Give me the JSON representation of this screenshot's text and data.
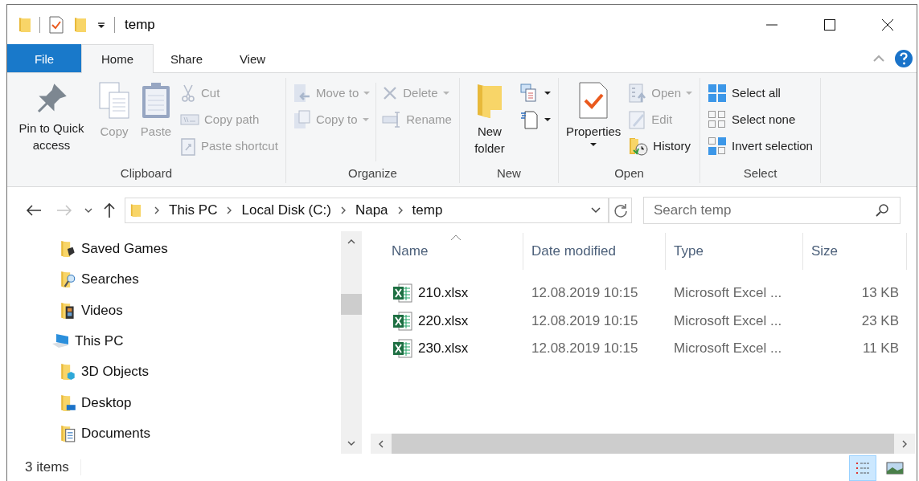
{
  "window": {
    "title": "temp"
  },
  "ribbon_tabs": [
    {
      "label": "File",
      "kind": "file",
      "selected": false
    },
    {
      "label": "Home",
      "kind": "tab",
      "selected": true
    },
    {
      "label": "Share",
      "kind": "tab",
      "selected": false
    },
    {
      "label": "View",
      "kind": "tab",
      "selected": false
    }
  ],
  "ribbon": {
    "groups": [
      {
        "label": "Clipboard",
        "columns": [
          [
            {
              "kind": "large",
              "label": "Pin to Quick access",
              "disabled": false,
              "dropdown": false
            }
          ],
          [
            {
              "kind": "large",
              "label": "Copy",
              "disabled": true,
              "dropdown": false
            }
          ],
          [
            {
              "kind": "large",
              "label": "Paste",
              "disabled": true,
              "dropdown": false
            }
          ],
          [
            {
              "kind": "small",
              "label": "Cut",
              "disabled": true,
              "dropdown": false
            },
            {
              "kind": "small",
              "label": "Copy path",
              "disabled": true,
              "dropdown": false
            },
            {
              "kind": "small",
              "label": "Paste shortcut",
              "disabled": true,
              "dropdown": false
            }
          ]
        ]
      },
      {
        "label": "Organize",
        "columns": [
          [
            {
              "kind": "small",
              "label": "Move to",
              "disabled": true,
              "dropdown": true
            },
            {
              "kind": "small",
              "label": "Copy to",
              "disabled": true,
              "dropdown": true
            }
          ],
          [
            {
              "kind": "small",
              "label": "Delete",
              "disabled": true,
              "dropdown": true
            },
            {
              "kind": "small",
              "label": "Rename",
              "disabled": true,
              "dropdown": false
            }
          ]
        ]
      },
      {
        "label": "New",
        "columns": [
          [
            {
              "kind": "large",
              "label": "New folder",
              "disabled": false,
              "dropdown": false
            }
          ],
          [
            {
              "kind": "icon",
              "disabled": false,
              "dropdown": true
            },
            {
              "kind": "icon",
              "disabled": false,
              "dropdown": true
            }
          ]
        ]
      },
      {
        "label": "Open",
        "columns": [
          [
            {
              "kind": "large",
              "label": "Properties",
              "disabled": false,
              "dropdown": true
            }
          ],
          [
            {
              "kind": "small",
              "label": "Open",
              "disabled": true,
              "dropdown": true
            },
            {
              "kind": "small",
              "label": "Edit",
              "disabled": true,
              "dropdown": false
            },
            {
              "kind": "small",
              "label": "History",
              "disabled": false,
              "dropdown": false
            }
          ]
        ]
      },
      {
        "label": "Select",
        "columns": [
          [
            {
              "kind": "small",
              "label": "Select all",
              "disabled": false,
              "dropdown": false
            },
            {
              "kind": "small",
              "label": "Select none",
              "disabled": false,
              "dropdown": false
            },
            {
              "kind": "small",
              "label": "Invert selection",
              "disabled": false,
              "dropdown": false
            }
          ]
        ]
      }
    ]
  },
  "navigation": {
    "forward_disabled": true
  },
  "breadcrumb": [
    "This PC",
    "Local Disk (C:)",
    "Napa",
    "temp"
  ],
  "search": {
    "placeholder": "Search temp"
  },
  "tree": [
    {
      "kind": "continued",
      "children": [
        {
          "label": "Saved Games"
        },
        {
          "label": "Searches"
        },
        {
          "label": "Videos"
        }
      ]
    },
    {
      "kind": "node",
      "label": "This PC",
      "children": [
        {
          "label": "3D Objects"
        },
        {
          "label": "Desktop"
        },
        {
          "label": "Documents"
        }
      ]
    }
  ],
  "files": {
    "columns": [
      {
        "label": "Name",
        "sorted": true
      },
      {
        "label": "Date modified",
        "sorted": false
      },
      {
        "label": "Type",
        "sorted": false
      },
      {
        "label": "Size",
        "sorted": false
      }
    ],
    "rows": [
      {
        "name": "210.xlsx",
        "date": "12.08.2019 10:15",
        "type": "Microsoft Excel ...",
        "size": "13 KB"
      },
      {
        "name": "220.xlsx",
        "date": "12.08.2019 10:15",
        "type": "Microsoft Excel ...",
        "size": "23 KB"
      },
      {
        "name": "230.xlsx",
        "date": "12.08.2019 10:15",
        "type": "Microsoft Excel ...",
        "size": "11 KB"
      }
    ]
  },
  "status_bar": {
    "count": "3 items",
    "views": [
      {
        "selected": true
      },
      {
        "selected": false
      }
    ]
  }
}
